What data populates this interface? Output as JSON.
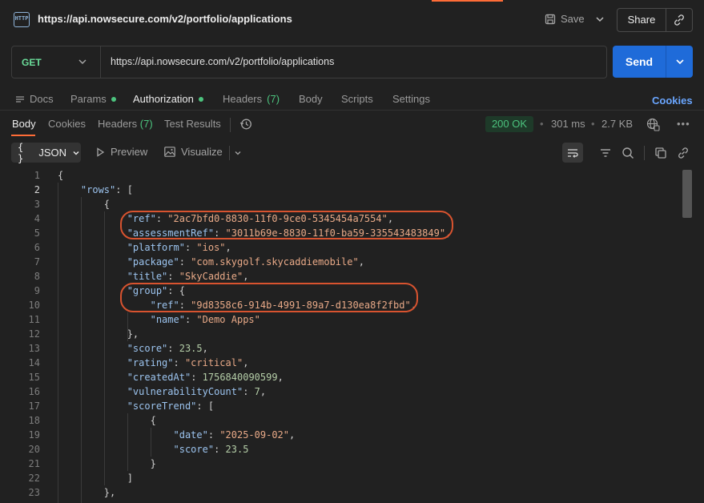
{
  "title_bar": {
    "url": "https://api.nowsecure.com/v2/portfolio/applications",
    "save_label": "Save",
    "share_label": "Share"
  },
  "request": {
    "method": "GET",
    "url": "https://api.nowsecure.com/v2/portfolio/applications",
    "send_label": "Send"
  },
  "request_tabs": {
    "docs": "Docs",
    "params": "Params",
    "authorization": "Authorization",
    "headers": "Headers",
    "headers_count": "(7)",
    "body": "Body",
    "scripts": "Scripts",
    "settings": "Settings",
    "cookies_link": "Cookies"
  },
  "response_tabs": {
    "body": "Body",
    "cookies": "Cookies",
    "headers": "Headers",
    "headers_count": "(7)",
    "test_results": "Test Results",
    "status": "200 OK",
    "time": "301 ms",
    "size": "2.7 KB",
    "more": "•••"
  },
  "response_toolbar": {
    "format": "JSON",
    "preview": "Preview",
    "visualize": "Visualize"
  },
  "code_lines": [
    {
      "n": "1",
      "t": [
        {
          "c": "",
          "v": "{"
        }
      ]
    },
    {
      "n": "2",
      "t": [
        {
          "c": "",
          "v": "    "
        },
        {
          "c": "k",
          "v": "\"rows\""
        },
        {
          "c": "",
          "v": ": ["
        }
      ]
    },
    {
      "n": "3",
      "t": [
        {
          "c": "",
          "v": "        {"
        }
      ]
    },
    {
      "n": "4",
      "t": [
        {
          "c": "",
          "v": "            "
        },
        {
          "c": "k",
          "v": "\"ref\""
        },
        {
          "c": "",
          "v": ": "
        },
        {
          "c": "s",
          "v": "\"2ac7bfd0-8830-11f0-9ce0-5345454a7554\""
        },
        {
          "c": "",
          "v": ","
        }
      ]
    },
    {
      "n": "5",
      "t": [
        {
          "c": "",
          "v": "            "
        },
        {
          "c": "k",
          "v": "\"assessmentRef\""
        },
        {
          "c": "",
          "v": ": "
        },
        {
          "c": "s",
          "v": "\"3011b69e-8830-11f0-ba59-335543483849\""
        },
        {
          "c": "",
          "v": ","
        }
      ]
    },
    {
      "n": "6",
      "t": [
        {
          "c": "",
          "v": "            "
        },
        {
          "c": "k",
          "v": "\"platform\""
        },
        {
          "c": "",
          "v": ": "
        },
        {
          "c": "s",
          "v": "\"ios\""
        },
        {
          "c": "",
          "v": ","
        }
      ]
    },
    {
      "n": "7",
      "t": [
        {
          "c": "",
          "v": "            "
        },
        {
          "c": "k",
          "v": "\"package\""
        },
        {
          "c": "",
          "v": ": "
        },
        {
          "c": "s",
          "v": "\"com.skygolf.skycaddiemobile\""
        },
        {
          "c": "",
          "v": ","
        }
      ]
    },
    {
      "n": "8",
      "t": [
        {
          "c": "",
          "v": "            "
        },
        {
          "c": "k",
          "v": "\"title\""
        },
        {
          "c": "",
          "v": ": "
        },
        {
          "c": "s",
          "v": "\"SkyCaddie\""
        },
        {
          "c": "",
          "v": ","
        }
      ]
    },
    {
      "n": "9",
      "t": [
        {
          "c": "",
          "v": "            "
        },
        {
          "c": "k",
          "v": "\"group\""
        },
        {
          "c": "",
          "v": ": {"
        }
      ]
    },
    {
      "n": "10",
      "t": [
        {
          "c": "",
          "v": "                "
        },
        {
          "c": "k",
          "v": "\"ref\""
        },
        {
          "c": "",
          "v": ": "
        },
        {
          "c": "s",
          "v": "\"9d8358c6-914b-4991-89a7-d130ea8f2fbd\""
        },
        {
          "c": "",
          "v": ","
        }
      ]
    },
    {
      "n": "11",
      "t": [
        {
          "c": "",
          "v": "                "
        },
        {
          "c": "k",
          "v": "\"name\""
        },
        {
          "c": "",
          "v": ": "
        },
        {
          "c": "s",
          "v": "\"Demo Apps\""
        }
      ]
    },
    {
      "n": "12",
      "t": [
        {
          "c": "",
          "v": "            },"
        }
      ]
    },
    {
      "n": "13",
      "t": [
        {
          "c": "",
          "v": "            "
        },
        {
          "c": "k",
          "v": "\"score\""
        },
        {
          "c": "",
          "v": ": "
        },
        {
          "c": "n",
          "v": "23.5"
        },
        {
          "c": "",
          "v": ","
        }
      ]
    },
    {
      "n": "14",
      "t": [
        {
          "c": "",
          "v": "            "
        },
        {
          "c": "k",
          "v": "\"rating\""
        },
        {
          "c": "",
          "v": ": "
        },
        {
          "c": "s",
          "v": "\"critical\""
        },
        {
          "c": "",
          "v": ","
        }
      ]
    },
    {
      "n": "15",
      "t": [
        {
          "c": "",
          "v": "            "
        },
        {
          "c": "k",
          "v": "\"createdAt\""
        },
        {
          "c": "",
          "v": ": "
        },
        {
          "c": "n",
          "v": "1756840090599"
        },
        {
          "c": "",
          "v": ","
        }
      ]
    },
    {
      "n": "16",
      "t": [
        {
          "c": "",
          "v": "            "
        },
        {
          "c": "k",
          "v": "\"vulnerabilityCount\""
        },
        {
          "c": "",
          "v": ": "
        },
        {
          "c": "n",
          "v": "7"
        },
        {
          "c": "",
          "v": ","
        }
      ]
    },
    {
      "n": "17",
      "t": [
        {
          "c": "",
          "v": "            "
        },
        {
          "c": "k",
          "v": "\"scoreTrend\""
        },
        {
          "c": "",
          "v": ": ["
        }
      ]
    },
    {
      "n": "18",
      "t": [
        {
          "c": "",
          "v": "                {"
        }
      ]
    },
    {
      "n": "19",
      "t": [
        {
          "c": "",
          "v": "                    "
        },
        {
          "c": "k",
          "v": "\"date\""
        },
        {
          "c": "",
          "v": ": "
        },
        {
          "c": "s",
          "v": "\"2025-09-02\""
        },
        {
          "c": "",
          "v": ","
        }
      ]
    },
    {
      "n": "20",
      "t": [
        {
          "c": "",
          "v": "                    "
        },
        {
          "c": "k",
          "v": "\"score\""
        },
        {
          "c": "",
          "v": ": "
        },
        {
          "c": "n",
          "v": "23.5"
        }
      ]
    },
    {
      "n": "21",
      "t": [
        {
          "c": "",
          "v": "                }"
        }
      ]
    },
    {
      "n": "22",
      "t": [
        {
          "c": "",
          "v": "            ]"
        }
      ]
    },
    {
      "n": "23",
      "t": [
        {
          "c": "",
          "v": "        },"
        }
      ]
    }
  ],
  "colors": {
    "accent": "#ff6c37",
    "send": "#1f6bd9",
    "status_ok": "#4cc37e",
    "json_key": "#9cc4ef",
    "json_string": "#e8a987",
    "json_number": "#b5cea8",
    "annotation": "#d8532f"
  }
}
